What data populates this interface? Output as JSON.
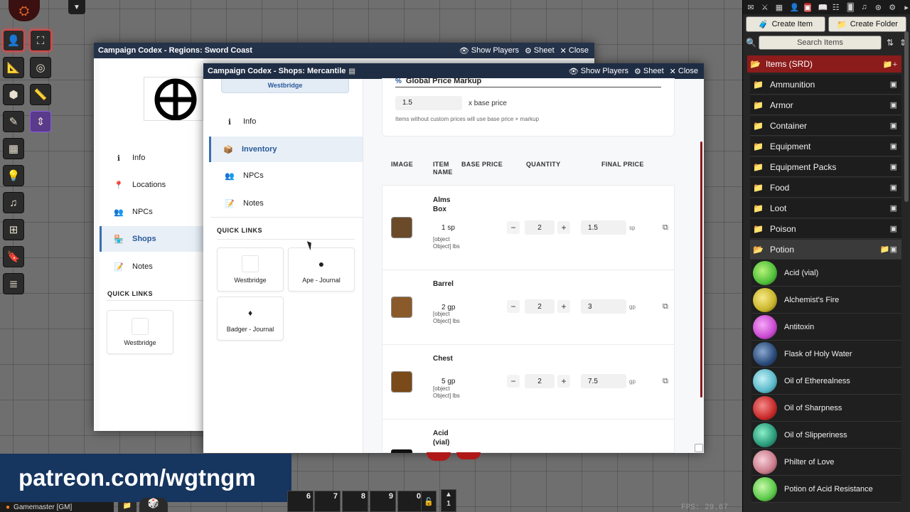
{
  "scene_tools": {
    "icons": [
      "person-icon",
      "expand-icon",
      "ruler-icon",
      "target-icon",
      "shapes-icon",
      "measure-icon",
      "pencil-icon",
      "arrows-icon",
      "wall-icon",
      "light-bulb-icon",
      "music-icon",
      "tile-icon",
      "bookmark-icon",
      "layers-icon"
    ]
  },
  "sidebar": {
    "create_item": "Create Item",
    "create_folder": "Create Folder",
    "search_placeholder": "Search Items",
    "root_folder": "Items (SRD)",
    "folders": [
      "Ammunition",
      "Armor",
      "Container",
      "Equipment",
      "Equipment Packs",
      "Food",
      "Loot",
      "Poison"
    ],
    "open_folder": "Potion",
    "potions": [
      {
        "label": "Acid (vial)",
        "color": "#4fbf3a"
      },
      {
        "label": "Alchemist's Fire",
        "color": "#c9b42a"
      },
      {
        "label": "Antitoxin",
        "color": "#c94ad0"
      },
      {
        "label": "Flask of Holy Water",
        "color": "#2a4a7a"
      },
      {
        "label": "Oil of Etherealness",
        "color": "#5ab8c9"
      },
      {
        "label": "Oil of Sharpness",
        "color": "#c92a2a"
      },
      {
        "label": "Oil of Slipperiness",
        "color": "#2a9a7a"
      },
      {
        "label": "Philter of Love",
        "color": "#c97a8a"
      },
      {
        "label": "Potion of Acid Resistance",
        "color": "#5ac94a"
      }
    ],
    "accent": "#8c1b1b"
  },
  "regions_window": {
    "title": "Campaign Codex - Regions: Sword Coast",
    "show_players": "Show Players",
    "sheet": "Sheet",
    "close": "Close",
    "nav": [
      "Info",
      "Locations",
      "NPCs",
      "Shops",
      "Notes"
    ],
    "active_nav": "Shops",
    "quick_links_label": "QUICK LINKS",
    "quick_links": [
      "Westbridge"
    ]
  },
  "shop_window": {
    "title": "Campaign Codex - Shops: Mercantile",
    "show_players": "Show Players",
    "sheet": "Sheet",
    "close": "Close",
    "header_chip": "Westbridge",
    "nav": [
      "Info",
      "Inventory",
      "NPCs",
      "Notes"
    ],
    "active_nav": "Inventory",
    "quick_links_label": "QUICK LINKS",
    "quick_links": [
      "Westbridge",
      "Ape - Journal",
      "Badger - Journal"
    ],
    "markup": {
      "heading": "Global Price Markup",
      "value": "1.5",
      "suffix": "x base price",
      "hint": "Items without custom prices will use base price × markup"
    },
    "table": {
      "headers": {
        "image": "IMAGE",
        "item_name": "ITEM NAME",
        "base_price": "BASE PRICE",
        "quantity": "QUANTITY",
        "final_price": "FINAL PRICE"
      },
      "rows": [
        {
          "name": "Alms Box",
          "base_price": "1 sp",
          "weight": "[object Object] lbs",
          "quantity": "2",
          "final_price": "1.5",
          "unit": "sp",
          "color": "#6b4a2a"
        },
        {
          "name": "Barrel",
          "base_price": "2 gp",
          "weight": "[object Object] lbs",
          "quantity": "2",
          "final_price": "3",
          "unit": "gp",
          "color": "#8a5a2a"
        },
        {
          "name": "Chest",
          "base_price": "5 gp",
          "weight": "[object Object] lbs",
          "quantity": "2",
          "final_price": "7.5",
          "unit": "gp",
          "color": "#7a4a1a"
        },
        {
          "name": "Acid (vial)"
        }
      ]
    }
  },
  "banner": "patreon.com/wgtngm",
  "hotbar": [
    "6",
    "7",
    "8",
    "9",
    "0"
  ],
  "hotbar_page": "1",
  "user": "Gamemaster [GM]",
  "fps_label": "FPS:",
  "fps_value": "29.67"
}
